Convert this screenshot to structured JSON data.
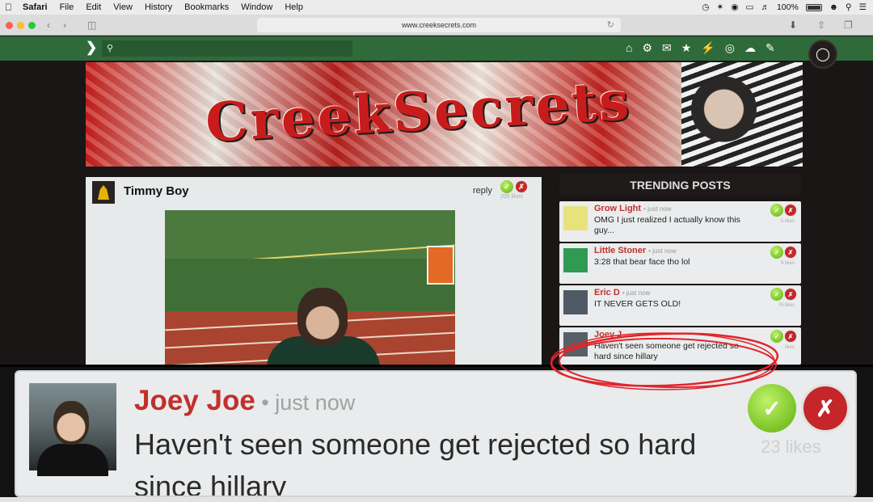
{
  "menubar": {
    "app": "Safari",
    "items": [
      "File",
      "Edit",
      "View",
      "History",
      "Bookmarks",
      "Window",
      "Help"
    ],
    "battery": "100%"
  },
  "browser": {
    "url": "www.creeksecrets.com"
  },
  "site": {
    "nav_icons": [
      "home-icon",
      "gear-icon",
      "mail-icon",
      "star-icon",
      "bolt-icon",
      "globe-icon",
      "cloud-icon",
      "pencil-icon"
    ],
    "banner_title": "CreekSecrets",
    "colors": {
      "nav_green": "#2f6b3a",
      "accent_red": "#c1302c",
      "upvote_green": "#79c326",
      "downvote_red": "#c4262a"
    }
  },
  "post": {
    "author": "Timmy Boy",
    "reply_label": "reply",
    "likes": "205 likes"
  },
  "trending": {
    "title": "TRENDING POSTS",
    "items": [
      {
        "name": "Grow Light",
        "time": "just now",
        "text": "OMG I just realized I actually know this guy...",
        "likes": "5 likes"
      },
      {
        "name": "Little Stoner",
        "time": "just now",
        "text": "3:28 that bear face tho lol",
        "likes": "9 likes"
      },
      {
        "name": "Eric D",
        "time": "just now",
        "text": "IT NEVER GETS OLD!",
        "likes": "76 likes"
      },
      {
        "name": "Joey J",
        "time": "",
        "text": "Haven't seen someone get rejected so hard since hillary",
        "likes": "likes"
      }
    ]
  },
  "zoom": {
    "name": "Joey Joe",
    "separator": " • ",
    "time": "just now",
    "text": "Haven't seen someone get rejected so hard since hillary",
    "likes": "23 likes"
  }
}
